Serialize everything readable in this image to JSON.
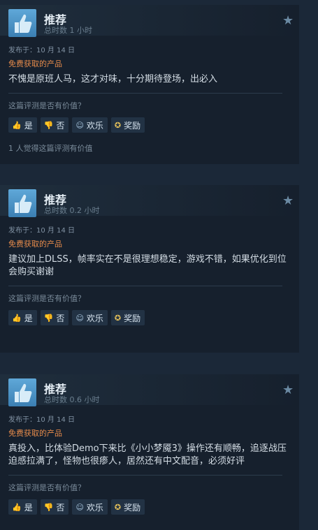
{
  "reviews": [
    {
      "recommend_label": "推荐",
      "hours": "总时数 1 小时",
      "posted": "发布于：10 月 14 日",
      "source": "免费获取的产品",
      "text": "不愧是原班人马，这才对味，十分期待登场，出必入",
      "helpful_question": "这篇评测是否有价值？",
      "buttons": {
        "yes": "是",
        "no": "否",
        "funny": "欢乐",
        "award": "奖励"
      },
      "helpful_count": "1 人觉得这篇评测有价值"
    },
    {
      "recommend_label": "推荐",
      "hours": "总时数 0.2 小时",
      "posted": "发布于：10 月 14 日",
      "source": "免费获取的产品",
      "text": "建议加上DLSS，帧率实在不是很理想稳定，游戏不错，如果优化到位会购买谢谢",
      "helpful_question": "这篇评测是否有价值？",
      "buttons": {
        "yes": "是",
        "no": "否",
        "funny": "欢乐",
        "award": "奖励"
      }
    },
    {
      "recommend_label": "推荐",
      "hours": "总时数 0.6 小时",
      "posted": "发布于：10 月 14 日",
      "source": "免费获取的产品",
      "text": "真投入，比体验Demo下来比《小小梦魇3》操作还有顺畅，追逐战压迫感拉满了，怪物也很瘆人，居然还有中文配音，必须好评",
      "helpful_question": "这篇评测是否有价值？",
      "buttons": {
        "yes": "是",
        "no": "否",
        "funny": "欢乐",
        "award": "奖励"
      }
    }
  ],
  "icons": {
    "recommend": "thumbs-up-icon",
    "star": "star-icon",
    "yes": "thumbs-up-icon",
    "no": "thumbs-down-icon",
    "funny": "smiley-icon",
    "award": "award-ribbon-icon"
  },
  "colors": {
    "background": "#1b2838",
    "card": "#16202d",
    "source_orange": "#e68b4b",
    "thumb_blue": "#4a90c4"
  }
}
